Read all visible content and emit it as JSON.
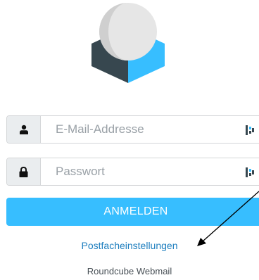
{
  "login": {
    "username": {
      "placeholder": "E-Mail-Addresse",
      "value": "",
      "icon": "user-icon"
    },
    "password": {
      "placeholder": "Passwort",
      "value": "",
      "icon": "lock-icon"
    },
    "submit_label": "ANMELDEN"
  },
  "links": {
    "mailbox_settings": "Postfacheinstellungen"
  },
  "footer": {
    "product_name": "Roundcube Webmail"
  },
  "colors": {
    "accent": "#37beff",
    "link": "#1f7fbf",
    "logo_dark": "#37474f",
    "logo_blue": "#37beff"
  }
}
